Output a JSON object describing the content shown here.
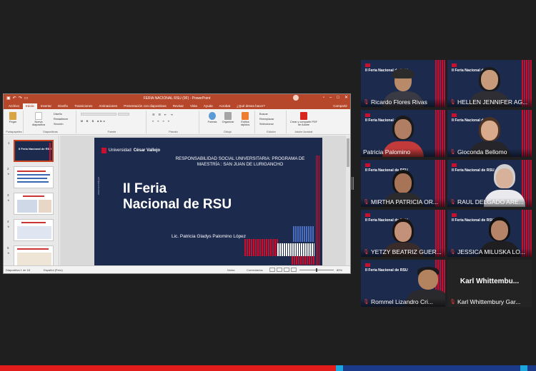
{
  "powerpoint": {
    "window_title": "FERIA NACIONAL RSU (9F) - PowerPoint",
    "tabs": [
      "Archivo",
      "Inicio",
      "Insertar",
      "Diseño",
      "Transiciones",
      "Animaciones",
      "Presentación con diapositivas",
      "Revisar",
      "Vista",
      "Ayuda",
      "Acrobat",
      "¿Qué desea hacer?"
    ],
    "active_tab": "Inicio",
    "share_label": "Compartir",
    "ribbon": {
      "groups": [
        "Portapapeles",
        "Diapositivas",
        "Fuente",
        "Párrafo",
        "Dibujo",
        "Edición",
        "Adobe Acrobat"
      ],
      "paste_label": "Pegar",
      "new_slide_label": "Nueva diapositiva",
      "design_label": "Diseño",
      "reset_label": "Restablecer",
      "section_label": "Sección",
      "shapes_label": "Formas",
      "arrange_label": "Organizar",
      "quick_styles_label": "Estilos rápidos",
      "find_label": "Buscar",
      "replace_label": "Reemplazar",
      "select_label": "Seleccionar",
      "acrobat_label": "Crear y compartir PDF de Adobe"
    },
    "thumbnails": [
      {
        "num": "1",
        "title": "II Feria Nacional de RSU"
      },
      {
        "num": "2",
        "title": ""
      },
      {
        "num": "3",
        "title": ""
      },
      {
        "num": "4",
        "title": ""
      },
      {
        "num": "5",
        "title": ""
      }
    ],
    "slide": {
      "logo_text": "Universidad",
      "logo_bold": "César Vallejo",
      "subtitle": "RESPONSABILIDAD SOCIAL UNIVERSITARIA: PROGRAMA DE MAESTRÍA : SAN JUAN DE LURIGANCHO",
      "title_line1": "II Feria",
      "title_line2": "Nacional de RSU",
      "author": "Lic. Patricia Gladys Palomino López",
      "side_url": "www.ucv.edu.pe"
    },
    "status": {
      "slide_counter": "Diapositiva 1 de 18",
      "language": "Español (Perú)",
      "notes": "Notas",
      "comments": "Comentarios",
      "zoom": "80%"
    }
  },
  "participants": [
    {
      "name": "Ricardo Flores Rivas",
      "muted": true,
      "active": false
    },
    {
      "name": "HELLEN JENNIFER AG...",
      "muted": true,
      "active": false
    },
    {
      "name": "Patricia Palomino",
      "muted": false,
      "active": true
    },
    {
      "name": "Gioconda Bellomo",
      "muted": true,
      "active": false
    },
    {
      "name": "MIRTHA PATRICIA OR...",
      "muted": true,
      "active": false
    },
    {
      "name": "RAUL DELGADO ARE...",
      "muted": true,
      "active": false
    },
    {
      "name": "YETZY BEATRIZ GUER...",
      "muted": true,
      "active": false
    },
    {
      "name": "JESSICA MILUSKA LO...",
      "muted": true,
      "active": false
    },
    {
      "name": "Rommel Lizandro Cri...",
      "muted": true,
      "active": false
    },
    {
      "name": "Karl Whittembury Gar...",
      "muted": true,
      "active": false,
      "video_off_label": "Karl  Whittembu..."
    }
  ],
  "tile_background_text": "II Feria Nacional de RSU",
  "colors": {
    "ppt_accent": "#b7472a",
    "slide_bg": "#1c2a4e",
    "ucv_red": "#c8102e",
    "active_speaker": "#d6d05b",
    "muted_icon": "#e23b3b"
  }
}
